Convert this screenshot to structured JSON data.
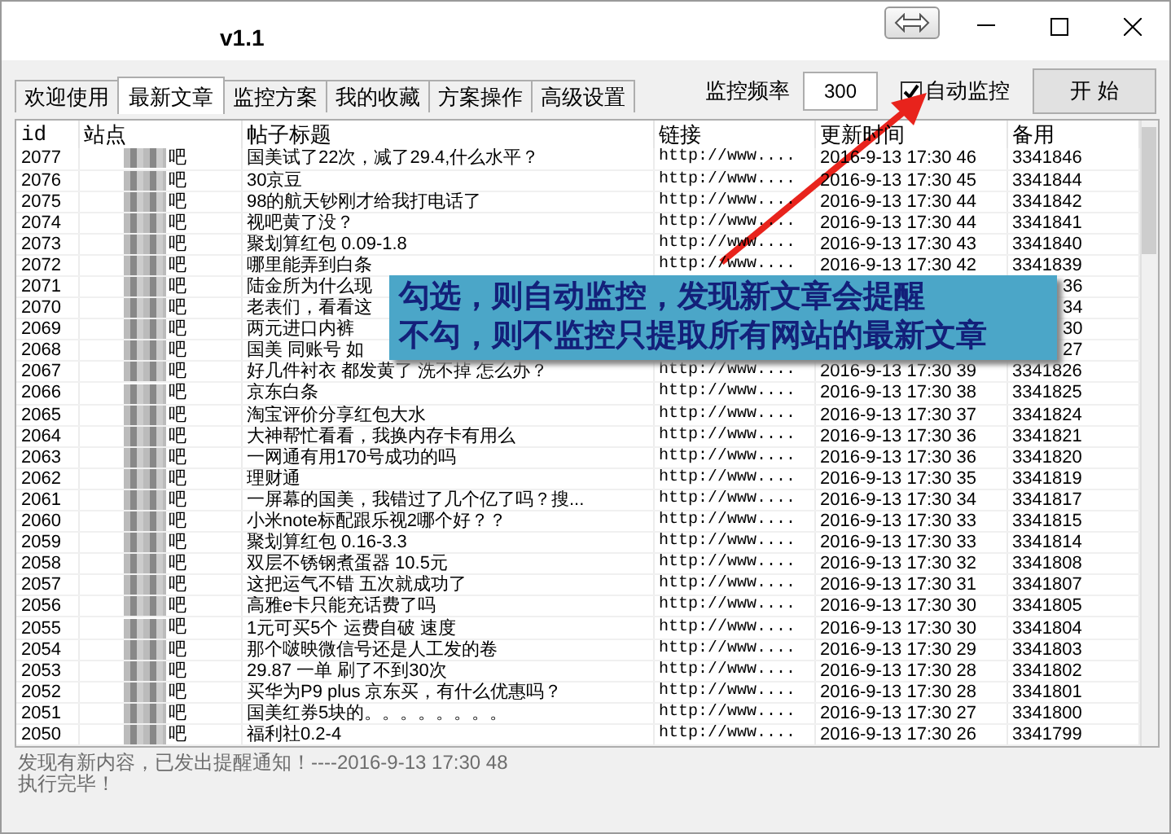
{
  "window": {
    "title": "v1.1"
  },
  "tabs": [
    {
      "label": "欢迎使用",
      "selected": false
    },
    {
      "label": "最新文章",
      "selected": true
    },
    {
      "label": "监控方案",
      "selected": false
    },
    {
      "label": "我的收藏",
      "selected": false
    },
    {
      "label": "方案操作",
      "selected": false
    },
    {
      "label": "高级设置",
      "selected": false
    }
  ],
  "monitor": {
    "frequency_label": "监控频率",
    "frequency_value": "300",
    "auto_label": "自动监控",
    "auto_checked": true,
    "start_button": "开 始"
  },
  "table": {
    "columns": [
      "id",
      "站点",
      "帖子标题",
      "链接",
      "更新时间",
      "备用"
    ],
    "rows": [
      {
        "id": "2077",
        "site": "吧",
        "title": "国美试了22次，减了29.4,什么水平？",
        "link": "http://www....",
        "time": "2016-9-13 17:30 46",
        "backup": "3341846"
      },
      {
        "id": "2076",
        "site": "吧",
        "title": "30京豆",
        "link": "http://www....",
        "time": "2016-9-13 17:30 45",
        "backup": "3341844"
      },
      {
        "id": "2075",
        "site": "吧",
        "title": "98的航天钞刚才给我打电话了",
        "link": "http://www....",
        "time": "2016-9-13 17:30 44",
        "backup": "3341842"
      },
      {
        "id": "2074",
        "site": "吧",
        "title": "视吧黄了没？",
        "link": "http://www....",
        "time": "2016-9-13 17:30 44",
        "backup": "3341841"
      },
      {
        "id": "2073",
        "site": "吧",
        "title": "聚划算红包 0.09-1.8",
        "link": "http://www....",
        "time": "2016-9-13 17:30 43",
        "backup": "3341840"
      },
      {
        "id": "2072",
        "site": "吧",
        "title": "哪里能弄到白条",
        "link": "http://www....",
        "time": "2016-9-13 17:30 42",
        "backup": "3341839"
      },
      {
        "id": "2071",
        "site": "吧",
        "title": "陆金所为什么现",
        "backup": "36",
        "backup_cut": true
      },
      {
        "id": "2070",
        "site": "吧",
        "title": "老表们，看看这",
        "backup": "34",
        "backup_cut": true
      },
      {
        "id": "2069",
        "site": "吧",
        "title": "两元进口内裤",
        "backup": "30",
        "backup_cut": true
      },
      {
        "id": "2068",
        "site": "吧",
        "title": "国美 同账号 如",
        "backup": "27",
        "backup_cut": true
      },
      {
        "id": "2067",
        "site": "吧",
        "title": "好几件衬衣 都发黄了 洗不掉 怎么办？",
        "link": "http://www....",
        "time": "2016-9-13 17:30 39",
        "backup": "3341826"
      },
      {
        "id": "2066",
        "site": "吧",
        "title": "京东白条",
        "link": "http://www....",
        "time": "2016-9-13 17:30 38",
        "backup": "3341825"
      },
      {
        "id": "2065",
        "site": "吧",
        "title": "淘宝评价分享红包大水",
        "link": "http://www....",
        "time": "2016-9-13 17:30 37",
        "backup": "3341824"
      },
      {
        "id": "2064",
        "site": "吧",
        "title": "大神帮忙看看，我换内存卡有用么",
        "link": "http://www....",
        "time": "2016-9-13 17:30 36",
        "backup": "3341821"
      },
      {
        "id": "2063",
        "site": "吧",
        "title": "一网通有用170号成功的吗",
        "link": "http://www....",
        "time": "2016-9-13 17:30 36",
        "backup": "3341820"
      },
      {
        "id": "2062",
        "site": "吧",
        "title": "理财通",
        "link": "http://www....",
        "time": "2016-9-13 17:30 35",
        "backup": "3341819"
      },
      {
        "id": "2061",
        "site": "吧",
        "title": "一屏幕的国美，我错过了几个亿了吗？搜...",
        "link": "http://www....",
        "time": "2016-9-13 17:30 34",
        "backup": "3341817"
      },
      {
        "id": "2060",
        "site": "吧",
        "title": "小米note标配跟乐视2哪个好？？",
        "link": "http://www....",
        "time": "2016-9-13 17:30 33",
        "backup": "3341815"
      },
      {
        "id": "2059",
        "site": "吧",
        "title": "聚划算红包 0.16-3.3",
        "link": "http://www....",
        "time": "2016-9-13 17:30 33",
        "backup": "3341814"
      },
      {
        "id": "2058",
        "site": "吧",
        "title": "双层不锈钢煮蛋器 10.5元",
        "link": "http://www....",
        "time": "2016-9-13 17:30 32",
        "backup": "3341808"
      },
      {
        "id": "2057",
        "site": "吧",
        "title": "这把运气不错 五次就成功了",
        "link": "http://www....",
        "time": "2016-9-13 17:30 31",
        "backup": "3341807"
      },
      {
        "id": "2056",
        "site": "吧",
        "title": "高雅e卡只能充话费了吗",
        "link": "http://www....",
        "time": "2016-9-13 17:30 30",
        "backup": "3341805"
      },
      {
        "id": "2055",
        "site": "吧",
        "title": "1元可买5个 运费自破 速度",
        "link": "http://www....",
        "time": "2016-9-13 17:30 30",
        "backup": "3341804"
      },
      {
        "id": "2054",
        "site": "吧",
        "title": "那个啵映微信号还是人工发的卷",
        "link": "http://www....",
        "time": "2016-9-13 17:30 29",
        "backup": "3341803"
      },
      {
        "id": "2053",
        "site": "吧",
        "title": "29.87 一单 刷了不到30次",
        "link": "http://www....",
        "time": "2016-9-13 17:30 28",
        "backup": "3341802"
      },
      {
        "id": "2052",
        "site": "吧",
        "title": "买华为P9 plus 京东买，有什么优惠吗？",
        "link": "http://www....",
        "time": "2016-9-13 17:30 28",
        "backup": "3341801"
      },
      {
        "id": "2051",
        "site": "吧",
        "title": "国美红券5块的。。。。。。。。",
        "link": "http://www....",
        "time": "2016-9-13 17:30 27",
        "backup": "3341800"
      },
      {
        "id": "2050",
        "site": "吧",
        "title": "福利社0.2-4",
        "link": "http://www....",
        "time": "2016-9-13 17:30 26",
        "backup": "3341799"
      }
    ]
  },
  "log": [
    "发现有新内容，已发出提醒通知！----2016-9-13 17:30 48",
    "执行完毕！"
  ],
  "callout": {
    "lines": [
      "勾选，则自动监控，发现新文章会提醒",
      "不勾，则不监控只提取所有网站的最新文章"
    ]
  }
}
